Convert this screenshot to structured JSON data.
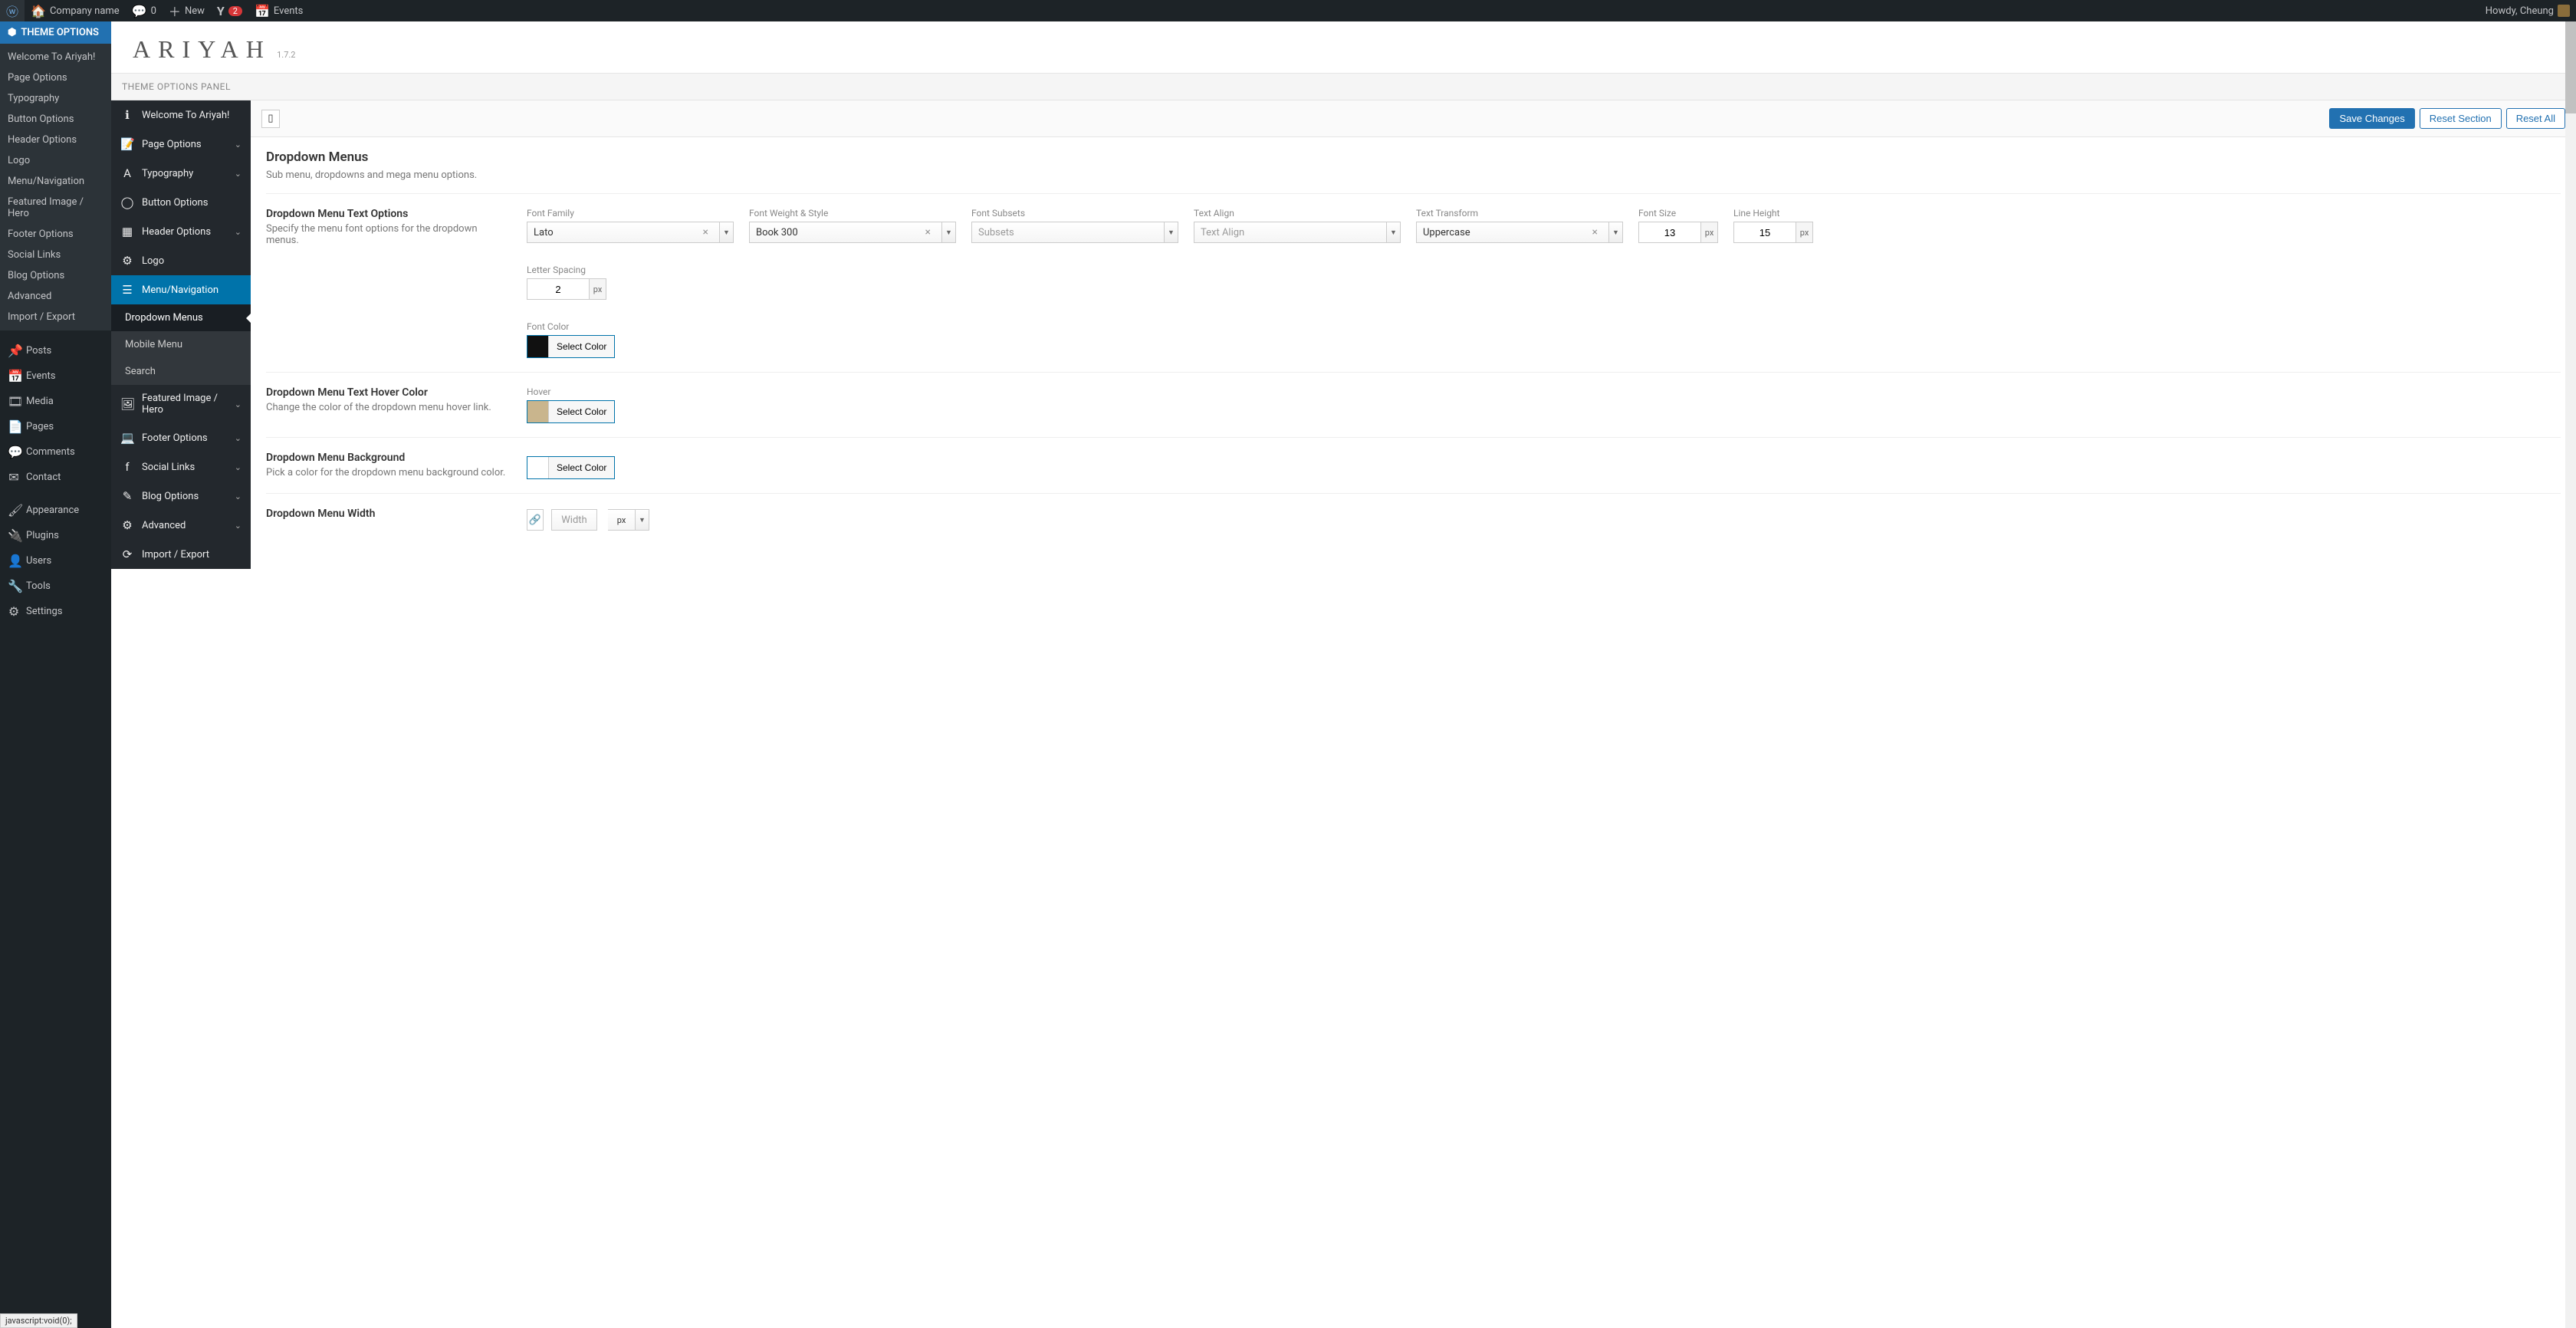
{
  "toolbar": {
    "company": "Company name",
    "comments": "0",
    "new": "New",
    "yoast_count": "2",
    "events": "Events",
    "howdy": "Howdy, Cheung"
  },
  "admin_sidebar": {
    "header": "THEME OPTIONS",
    "submenu": [
      "Welcome To Ariyah!",
      "Page Options",
      "Typography",
      "Button Options",
      "Header Options",
      "Logo",
      "Menu/Navigation",
      "Featured Image / Hero",
      "Footer Options",
      "Social Links",
      "Blog Options",
      "Advanced",
      "Import / Export"
    ],
    "main_items": [
      {
        "icon": "📌",
        "label": "Posts"
      },
      {
        "icon": "📅",
        "label": "Events"
      },
      {
        "icon": "🎞",
        "label": "Media"
      },
      {
        "icon": "📄",
        "label": "Pages"
      },
      {
        "icon": "💬",
        "label": "Comments"
      },
      {
        "icon": "✉",
        "label": "Contact"
      }
    ],
    "main_items2": [
      {
        "icon": "🖌",
        "label": "Appearance"
      },
      {
        "icon": "🔌",
        "label": "Plugins"
      },
      {
        "icon": "👤",
        "label": "Users"
      },
      {
        "icon": "🔧",
        "label": "Tools"
      },
      {
        "icon": "⚙",
        "label": "Settings"
      }
    ]
  },
  "theme": {
    "logo": "ARIYAH",
    "version": "1.7.2",
    "panel_title": "THEME OPTIONS PANEL"
  },
  "actions": {
    "save": "Save Changes",
    "reset_section": "Reset Section",
    "reset_all": "Reset All"
  },
  "options_sidebar": [
    {
      "icon": "ℹ",
      "label": "Welcome To Ariyah!",
      "expand": false
    },
    {
      "icon": "📝",
      "label": "Page Options",
      "expand": true
    },
    {
      "icon": "A",
      "label": "Typography",
      "expand": true
    },
    {
      "icon": "◯",
      "label": "Button Options",
      "expand": false
    },
    {
      "icon": "▦",
      "label": "Header Options",
      "expand": true
    },
    {
      "icon": "⚙",
      "label": "Logo",
      "expand": false
    },
    {
      "icon": "☰",
      "label": "Menu/Navigation",
      "expand": false,
      "active": true
    },
    {
      "sub": true,
      "label": "Dropdown Menus",
      "active": true
    },
    {
      "sub": true,
      "label": "Mobile Menu"
    },
    {
      "sub": true,
      "label": "Search"
    },
    {
      "icon": "🖼",
      "label": "Featured Image / Hero",
      "expand": true
    },
    {
      "icon": "💻",
      "label": "Footer Options",
      "expand": true
    },
    {
      "icon": "f",
      "label": "Social Links",
      "expand": true
    },
    {
      "icon": "✎",
      "label": "Blog Options",
      "expand": true
    },
    {
      "icon": "⚙",
      "label": "Advanced",
      "expand": true
    },
    {
      "icon": "⟳",
      "label": "Import / Export",
      "expand": false
    }
  ],
  "section": {
    "title": "Dropdown Menus",
    "desc": "Sub menu, dropdowns and mega menu options."
  },
  "text_options": {
    "title": "Dropdown Menu Text Options",
    "desc": "Specify the menu font options for the dropdown menus.",
    "font_family_label": "Font Family",
    "font_family": "Lato",
    "font_weight_label": "Font Weight & Style",
    "font_weight": "Book 300",
    "font_subsets_label": "Font Subsets",
    "font_subsets": "Subsets",
    "text_align_label": "Text Align",
    "text_align": "Text Align",
    "text_transform_label": "Text Transform",
    "text_transform": "Uppercase",
    "font_size_label": "Font Size",
    "font_size": "13",
    "line_height_label": "Line Height",
    "line_height": "15",
    "letter_spacing_label": "Letter Spacing",
    "letter_spacing": "2",
    "font_color_label": "Font Color",
    "select_color": "Select Color",
    "font_color": "#111111",
    "px": "px"
  },
  "hover_color": {
    "title": "Dropdown Menu Text Hover Color",
    "desc": "Change the color of the dropdown menu hover link.",
    "hover_label": "Hover",
    "select_color": "Select Color",
    "hover_color": "#c9b58d"
  },
  "bg": {
    "title": "Dropdown Menu Background",
    "desc": "Pick a color for the dropdown menu background color.",
    "select_color": "Select Color"
  },
  "width": {
    "title": "Dropdown Menu Width",
    "width_label": "Width",
    "px": "px"
  },
  "status": "javascript:void(0);"
}
